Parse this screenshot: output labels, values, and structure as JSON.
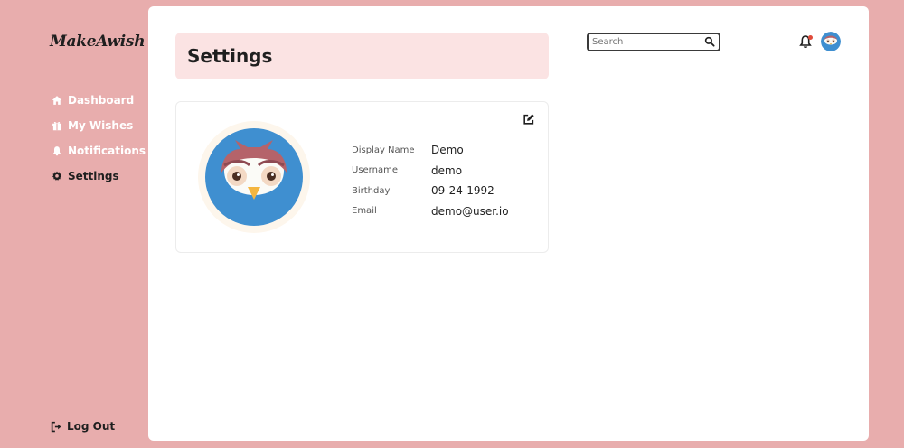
{
  "brand": {
    "logo": "MakeAwish"
  },
  "sidebar": {
    "items": [
      {
        "label": "Dashboard",
        "icon": "home-icon",
        "active": false
      },
      {
        "label": "My Wishes",
        "icon": "gift-icon",
        "active": false
      },
      {
        "label": "Notifications",
        "icon": "bell-icon",
        "active": false
      },
      {
        "label": "Settings",
        "icon": "gear-icon",
        "active": true
      }
    ],
    "logout_label": "Log Out"
  },
  "header": {
    "title": "Settings",
    "search_placeholder": "Search"
  },
  "profile": {
    "fields": [
      {
        "label": "Display Name",
        "value": "Demo"
      },
      {
        "label": "Username",
        "value": "demo"
      },
      {
        "label": "Birthday",
        "value": "09-24-1992"
      },
      {
        "label": "Email",
        "value": "demo@user.io"
      }
    ]
  },
  "colors": {
    "background": "#e8adad",
    "panel": "#ffffff",
    "title_card": "#fbe3e3",
    "notification_dot": "#e04a3a",
    "avatar_blue": "#3f8fd0"
  }
}
